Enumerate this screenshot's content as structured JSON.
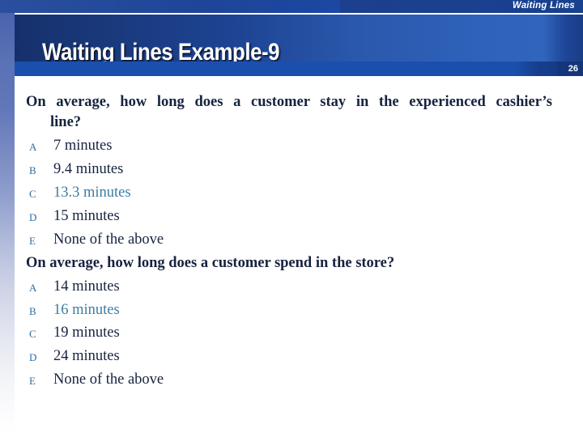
{
  "slide": {
    "header_label": "Waiting Lines",
    "title": "Waiting Lines Example-9",
    "page_number": "26",
    "colors": {
      "banner_dark": "#16306b",
      "banner_light": "#3165bd",
      "sub_bar": "#1b4fae",
      "body_text": "#16233f",
      "option_letter": "#2e6da4",
      "highlight_answer": "#3d7da2",
      "background": "#ffffff"
    }
  },
  "questions": [
    {
      "id": "question-1",
      "text_line_1": "On average, how long does a customer stay in the experienced cashier’s",
      "text_line_2": "line?",
      "options": [
        {
          "letter": "A",
          "text": "7 minutes",
          "highlighted": false
        },
        {
          "letter": "B",
          "text": "9.4 minutes",
          "highlighted": false
        },
        {
          "letter": "C",
          "text": "13.3 minutes",
          "highlighted": true
        },
        {
          "letter": "D",
          "text": "15 minutes",
          "highlighted": false
        },
        {
          "letter": "E",
          "text": "None of the above",
          "highlighted": false
        }
      ]
    },
    {
      "id": "question-2",
      "text_line_1": "On average, how long does a customer spend in the store?",
      "options": [
        {
          "letter": "A",
          "text": "14 minutes",
          "highlighted": false
        },
        {
          "letter": "B",
          "text": "16 minutes",
          "highlighted": true
        },
        {
          "letter": "C",
          "text": "19 minutes",
          "highlighted": false
        },
        {
          "letter": "D",
          "text": "24 minutes",
          "highlighted": false
        },
        {
          "letter": "E",
          "text": "None of the above",
          "highlighted": false
        }
      ]
    }
  ]
}
